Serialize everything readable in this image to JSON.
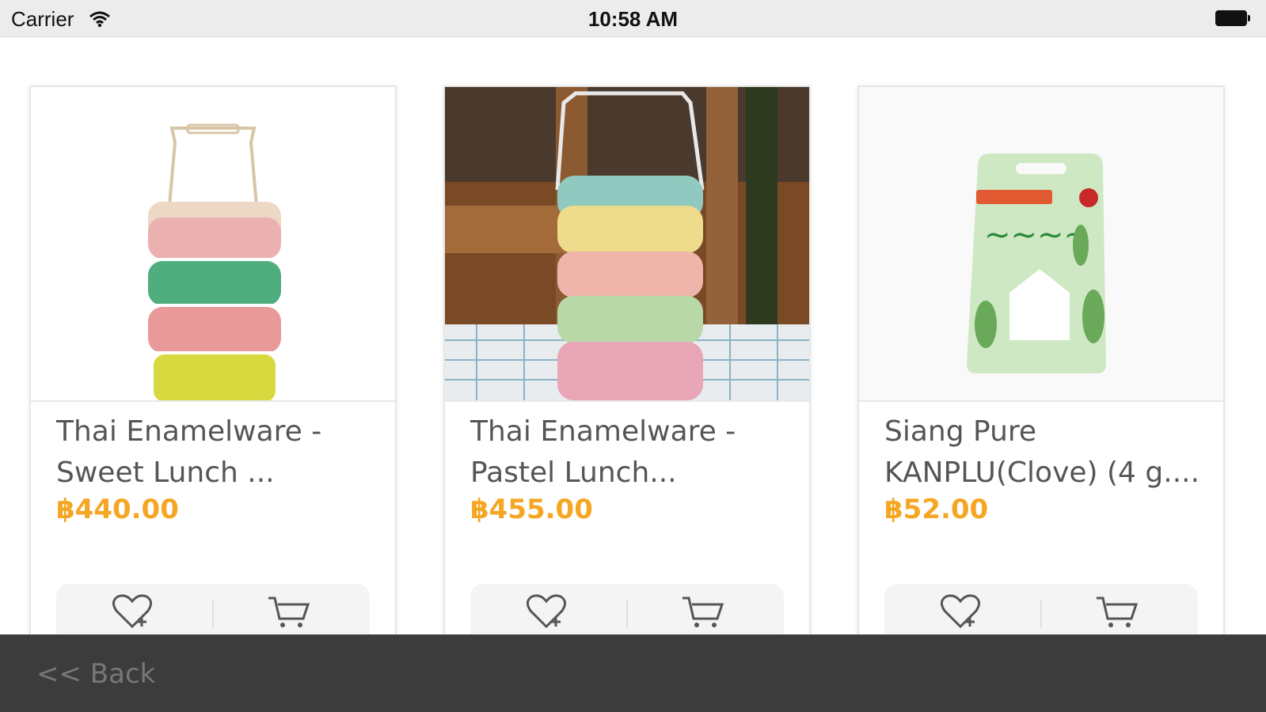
{
  "status_bar": {
    "carrier": "Carrier",
    "time": "10:58 AM",
    "wifi_icon": "wifi-icon",
    "battery_icon": "battery-icon"
  },
  "products": [
    {
      "title": "Thai Enamelware - Sweet Lunch ...",
      "price": "฿440.00",
      "image": "lunch-box-sweet"
    },
    {
      "title": "Thai Enamelware - Pastel Lunch...",
      "price": "฿455.00",
      "image": "lunch-box-pastel"
    },
    {
      "title": "Siang Pure KANPLU(Clove) (4 g....",
      "price": "฿52.00",
      "image": "kanplu-package"
    }
  ],
  "actions": {
    "favorite_icon": "heart-plus-icon",
    "cart_icon": "cart-icon"
  },
  "footer": {
    "back_label": "<< Back"
  },
  "colors": {
    "price": "#f5a623",
    "status_bar": "#ececec",
    "footer": "#3c3c3c"
  }
}
